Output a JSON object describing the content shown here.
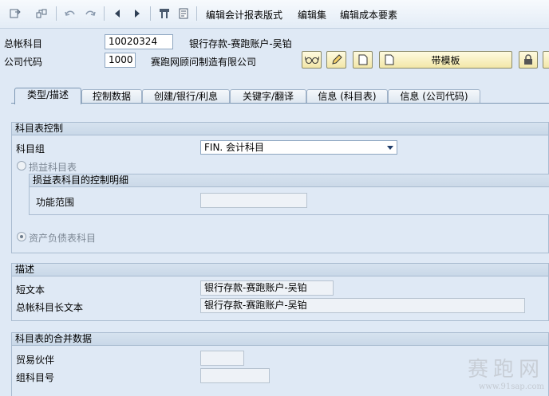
{
  "toolbar": {
    "menu_items": [
      "编辑会计报表版式",
      "编辑集",
      "编辑成本要素"
    ]
  },
  "header": {
    "gl_account_label": "总帐科目",
    "gl_account_value": "10020324",
    "gl_account_desc": "银行存款-赛跑账户-吴铂",
    "company_code_label": "公司代码",
    "company_code_value": "1000",
    "company_code_desc": "赛跑网顾问制造有限公司",
    "template_button_label": "带模板"
  },
  "tabs": [
    {
      "label": "类型/描述",
      "active": true
    },
    {
      "label": "控制数据",
      "active": false
    },
    {
      "label": "创建/银行/利息",
      "active": false
    },
    {
      "label": "关键字/翻译",
      "active": false
    },
    {
      "label": "信息 (科目表)",
      "active": false
    },
    {
      "label": "信息 (公司代码)",
      "active": false
    }
  ],
  "coa_control": {
    "title": "科目表控制",
    "account_group_label": "科目组",
    "account_group_value": "FIN. 会计科目",
    "pl_account_label": "损益科目表",
    "pl_detail_title": "损益表科目的控制明细",
    "functional_area_label": "功能范围",
    "functional_area_value": "",
    "bs_account_label": "资产负债表科目"
  },
  "description": {
    "title": "描述",
    "short_text_label": "短文本",
    "short_text_value": "银行存款-赛跑账户-吴铂",
    "long_text_label": "总帐科目长文本",
    "long_text_value": "银行存款-赛跑账户-吴铂"
  },
  "consolidation": {
    "title": "科目表的合并数据",
    "trading_partner_label": "贸易伙伴",
    "trading_partner_value": "",
    "group_account_label": "组科目号",
    "group_account_value": ""
  },
  "watermark": {
    "big": "赛跑网",
    "small": "www.91sap.com"
  },
  "colors": {
    "background": "#dfe9f5",
    "button_accent": "#f2e7a8"
  }
}
